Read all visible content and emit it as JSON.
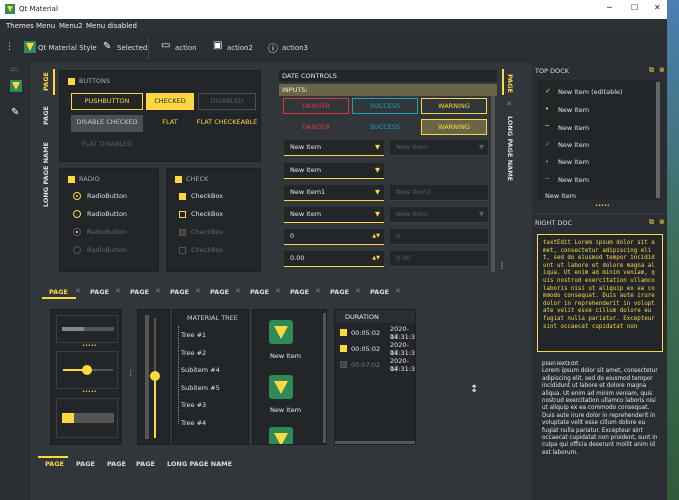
{
  "window": {
    "title": "Qt Material"
  },
  "menubar": {
    "items": [
      "Themes",
      "Menu",
      "Menu2",
      "Menu disabled"
    ]
  },
  "toolbar": {
    "app_label": "Qt Material Style",
    "selected": "Selected",
    "action": "action",
    "action2": "action2",
    "action3": "action3"
  },
  "left_vtabs": [
    "PAGE",
    "PAGE",
    "LONG PAGE NAME"
  ],
  "buttons": {
    "section": "BUTTONS",
    "pushbutton": "PUSHBUTTON",
    "checked": "CHECKED",
    "disabled": "DISABLED",
    "disable_checked": "DISABLE CHECKED",
    "flat": "FLAT",
    "flat_checkeable": "FLAT CHECKEABLE",
    "flat_disabled": "FLAT DISABLED"
  },
  "radio": {
    "section": "RADIO",
    "items": [
      "RadioButton",
      "RadioButton",
      "RadioButton",
      "RadioButton"
    ]
  },
  "check": {
    "section": "CHECK",
    "items": [
      "CheckBox",
      "CheckBox",
      "CheckBox",
      "CheckBox"
    ]
  },
  "controls": {
    "date_controls": "DATE CONTROLS",
    "inputs": "INPUTS:",
    "danger": "DANGER",
    "success": "SUCCESS",
    "warning": "WARNING",
    "combos": [
      "New Item",
      "New Item",
      "New Item1",
      "New Item"
    ],
    "combos_dis": [
      "New Item",
      "New Item1",
      "New Item"
    ],
    "spin1": "0",
    "spin1_dis": "0",
    "spin2": "0.00",
    "spin2_dis": "0.00"
  },
  "right_vtabs": [
    "PAGE",
    "LONG PAGE NAME"
  ],
  "bottom_tabs": [
    "PAGE",
    "PAGE",
    "PAGE",
    "PAGE",
    "PAGE",
    "PAGE",
    "PAGE",
    "PAGE",
    "PAGE"
  ],
  "tree": {
    "header": "MATERIAL TREE",
    "items": [
      "Tree #1",
      "Tree #2",
      "Subitem #4",
      "Subitem #5",
      "Tree #3",
      "Tree #4"
    ]
  },
  "icon_list": {
    "items": [
      "New Item",
      "New Item",
      "New Item"
    ]
  },
  "table": {
    "header": "DURATION",
    "rows": [
      {
        "time": "00:05:02",
        "date": "2020-04",
        "date2": "17:31:34"
      },
      {
        "time": "00:05:02",
        "date": "2020-04",
        "date2": "17:31:34"
      },
      {
        "time": "00:07:02",
        "date": "2020-04",
        "date2": "17:31:34"
      }
    ]
  },
  "bottom_bar_tabs": [
    "PAGE",
    "PAGE",
    "PAGE",
    "PAGE",
    "LONG PAGE NAME"
  ],
  "top_dock": {
    "title": "TOP DOCK",
    "items": [
      "New Item (editable)",
      "New Item",
      "New Item",
      "New Item",
      "New Item",
      "New Item",
      "New Item"
    ]
  },
  "right_doc": {
    "title": "RIGHT DOC",
    "text": "textEdit Lorem ipsum dolor sit amet, consectetur adipiscing elit, sed do eiusmod tempor incididunt ut labore et dolore magna aliqua. Ut enim ad minim veniam, quis nostrud exercitation ullamco laboris nisi ut aliquip ex ea commodo consequat. Duis aute irure dolor in reprehenderit in voluptate velit esse cillum dolore eu fugiat nulla pariatur. Excepteur sint occaecat cupidatat non",
    "plain": "plainTextEdit\nLorem ipsum dolor sit amet, consectetur adipiscing elit, sed do eiusmod tempor incididunt ut labore et dolore magna aliqua. Ut enim ad minim veniam, quis nostrud exercitation ullamco laboris nisi ut aliquip ex ea commodo consequat. Duis aute irure dolor in reprehenderit in voluptate velit esse cillum dolore eu fugiat nulla pariatur. Excepteur sint occaecat cupidatat non proident, sunt in culpa qui officia deserunt mollit anim id est laborum."
  },
  "colors": {
    "accent": "#ffd740",
    "bg": "#31363b",
    "panel": "#232629",
    "danger": "#dc3545",
    "success": "#17a2b8"
  }
}
